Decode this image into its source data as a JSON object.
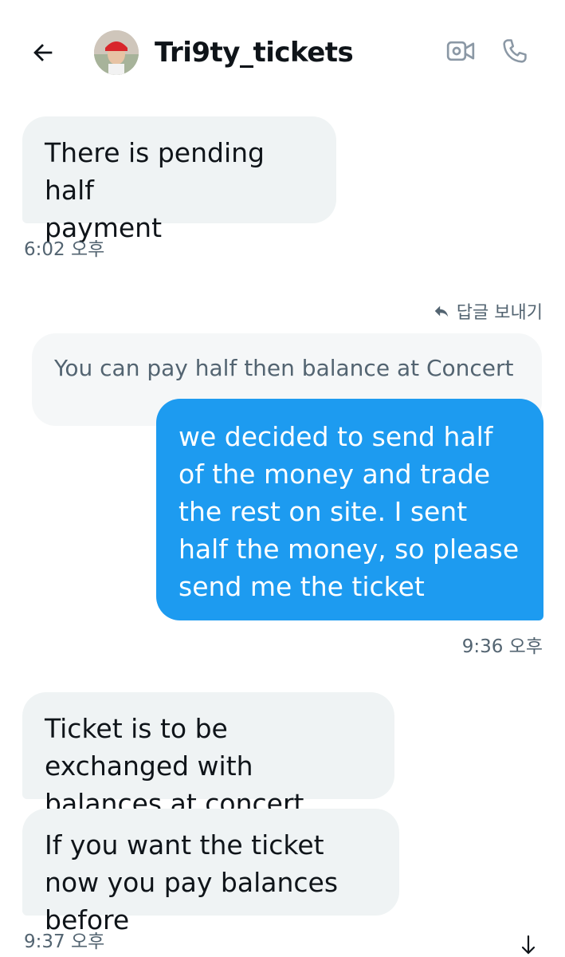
{
  "header": {
    "contact_name": "Tri9ty_tickets",
    "back_icon": "arrow-left-icon",
    "video_icon": "video-call-icon",
    "call_icon": "phone-icon"
  },
  "messages": [
    {
      "id": "m1",
      "direction": "incoming",
      "text": "There is pending half\npayment",
      "time": "6:02 오후"
    },
    {
      "id": "m2",
      "direction": "outgoing",
      "reply_label": "답글 보내기",
      "quoted_text": "You can pay  half then balance at Concert",
      "text": "we decided to send half of the money and trade the rest on site. I sent half the money, so please send me the ticket",
      "time": "9:36 오후"
    },
    {
      "id": "m3",
      "direction": "incoming",
      "text": "Ticket is to be exchanged with balances at concert"
    },
    {
      "id": "m4",
      "direction": "incoming",
      "text": "If you want the ticket now you pay balances before",
      "time": "9:37 오후"
    }
  ],
  "colors": {
    "outgoing_bubble": "#1d9bf0",
    "incoming_bubble": "#eff3f4",
    "secondary_text": "#536471"
  }
}
